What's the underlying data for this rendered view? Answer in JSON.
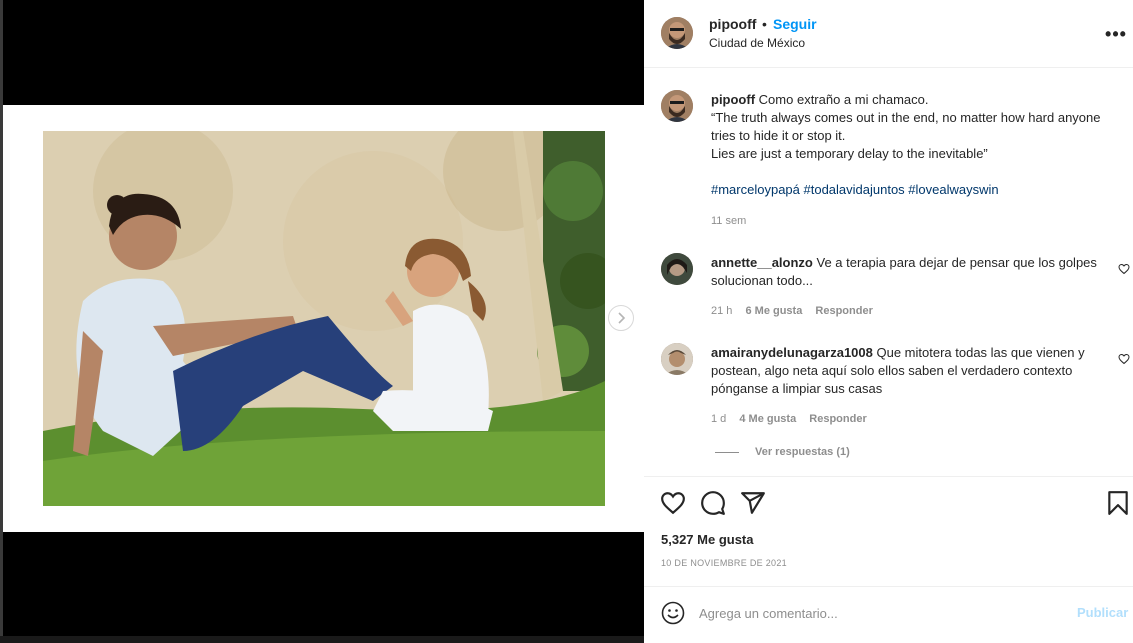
{
  "post": {
    "username": "pipooff",
    "follow_label": "Seguir",
    "location": "Ciudad de México",
    "caption_text_1": "Como extraño a mi chamaco.",
    "caption_text_2": "“The truth always comes out in the end, no matter how hard anyone tries to hide it or stop it.",
    "caption_text_3": "Lies are just a temporary delay to the inevitable”",
    "hashtags": "#marceloypapá #todalavidajuntos #lovealwayswin",
    "caption_time": "11 sem",
    "likes": "5,327 Me gusta",
    "date": "10 DE NOVIEMBRE DE 2021"
  },
  "comments": [
    {
      "username": "annette__alonzo",
      "text": "Ve a terapia para dejar de pensar que los golpes solucionan todo...",
      "time": "21 h",
      "likes": "6 Me gusta",
      "reply": "Responder"
    },
    {
      "username": "amairanydelunagarza1008",
      "text": "Que mitotera todas las que vienen y postean, algo neta aquí solo ellos saben el verdadero contexto pónganse a limpiar sus casas",
      "time": "1 d",
      "likes": "4 Me gusta",
      "reply": "Responder"
    }
  ],
  "view_replies": "Ver respuestas (1)",
  "composer": {
    "placeholder": "Agrega un comentario...",
    "publish": "Publicar"
  },
  "icons": [
    "more-options-icon",
    "heart-icon",
    "comment-icon",
    "share-icon",
    "bookmark-icon",
    "emoji-icon",
    "chevron-right-icon"
  ],
  "colors": {
    "link": "#0095f6",
    "hashtag": "#00376b",
    "muted": "#8e8e8e",
    "publish_disabled": "#b2dffc"
  }
}
